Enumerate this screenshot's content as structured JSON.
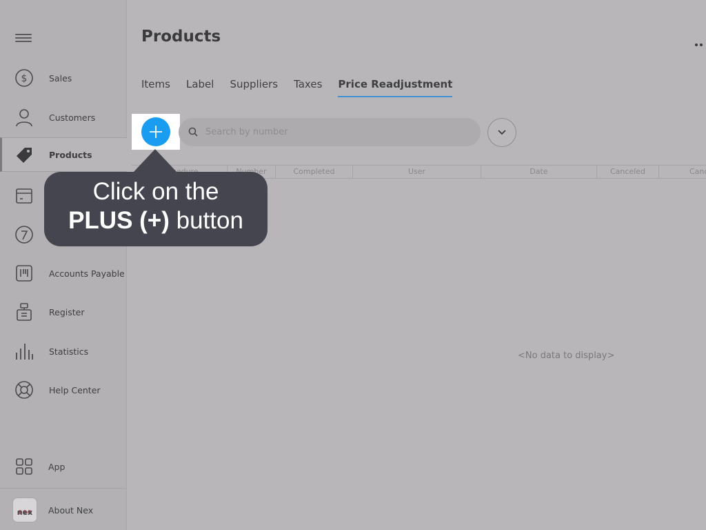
{
  "sidebar": {
    "items": [
      {
        "label": "Sales",
        "icon": "dollar-circle-icon"
      },
      {
        "label": "Customers",
        "icon": "person-icon"
      },
      {
        "label": "Products",
        "icon": "tag-icon",
        "active": true
      },
      {
        "label": "",
        "icon": "calendar-box-icon"
      },
      {
        "label": "",
        "icon": "chart-circle-icon"
      },
      {
        "label": "Accounts Payable",
        "icon": "barcode-icon"
      },
      {
        "label": "Register",
        "icon": "register-icon"
      },
      {
        "label": "Statistics",
        "icon": "bars-icon"
      },
      {
        "label": "Help Center",
        "icon": "lifebuoy-icon"
      }
    ],
    "app_label": "App",
    "about_label": "About Nex",
    "logo_text": "nex"
  },
  "header": {
    "title": "Products"
  },
  "tabs": [
    {
      "label": "Items"
    },
    {
      "label": "Label"
    },
    {
      "label": "Suppliers"
    },
    {
      "label": "Taxes"
    },
    {
      "label": "Price Readjustment",
      "active": true
    }
  ],
  "search": {
    "placeholder": "Search by number"
  },
  "table": {
    "columns": [
      "Procedure",
      "Number",
      "Completed",
      "User",
      "Date",
      "Canceled",
      "Canc"
    ],
    "empty_text": "<No data to display>"
  },
  "tooltip": {
    "line1": "Click on the",
    "line2_bold": "PLUS (+)",
    "line2_rest": " button"
  },
  "colors": {
    "accent": "#1a9cf0",
    "tab_underline": "#3d8fd4",
    "tooltip_bg": "#454550"
  }
}
